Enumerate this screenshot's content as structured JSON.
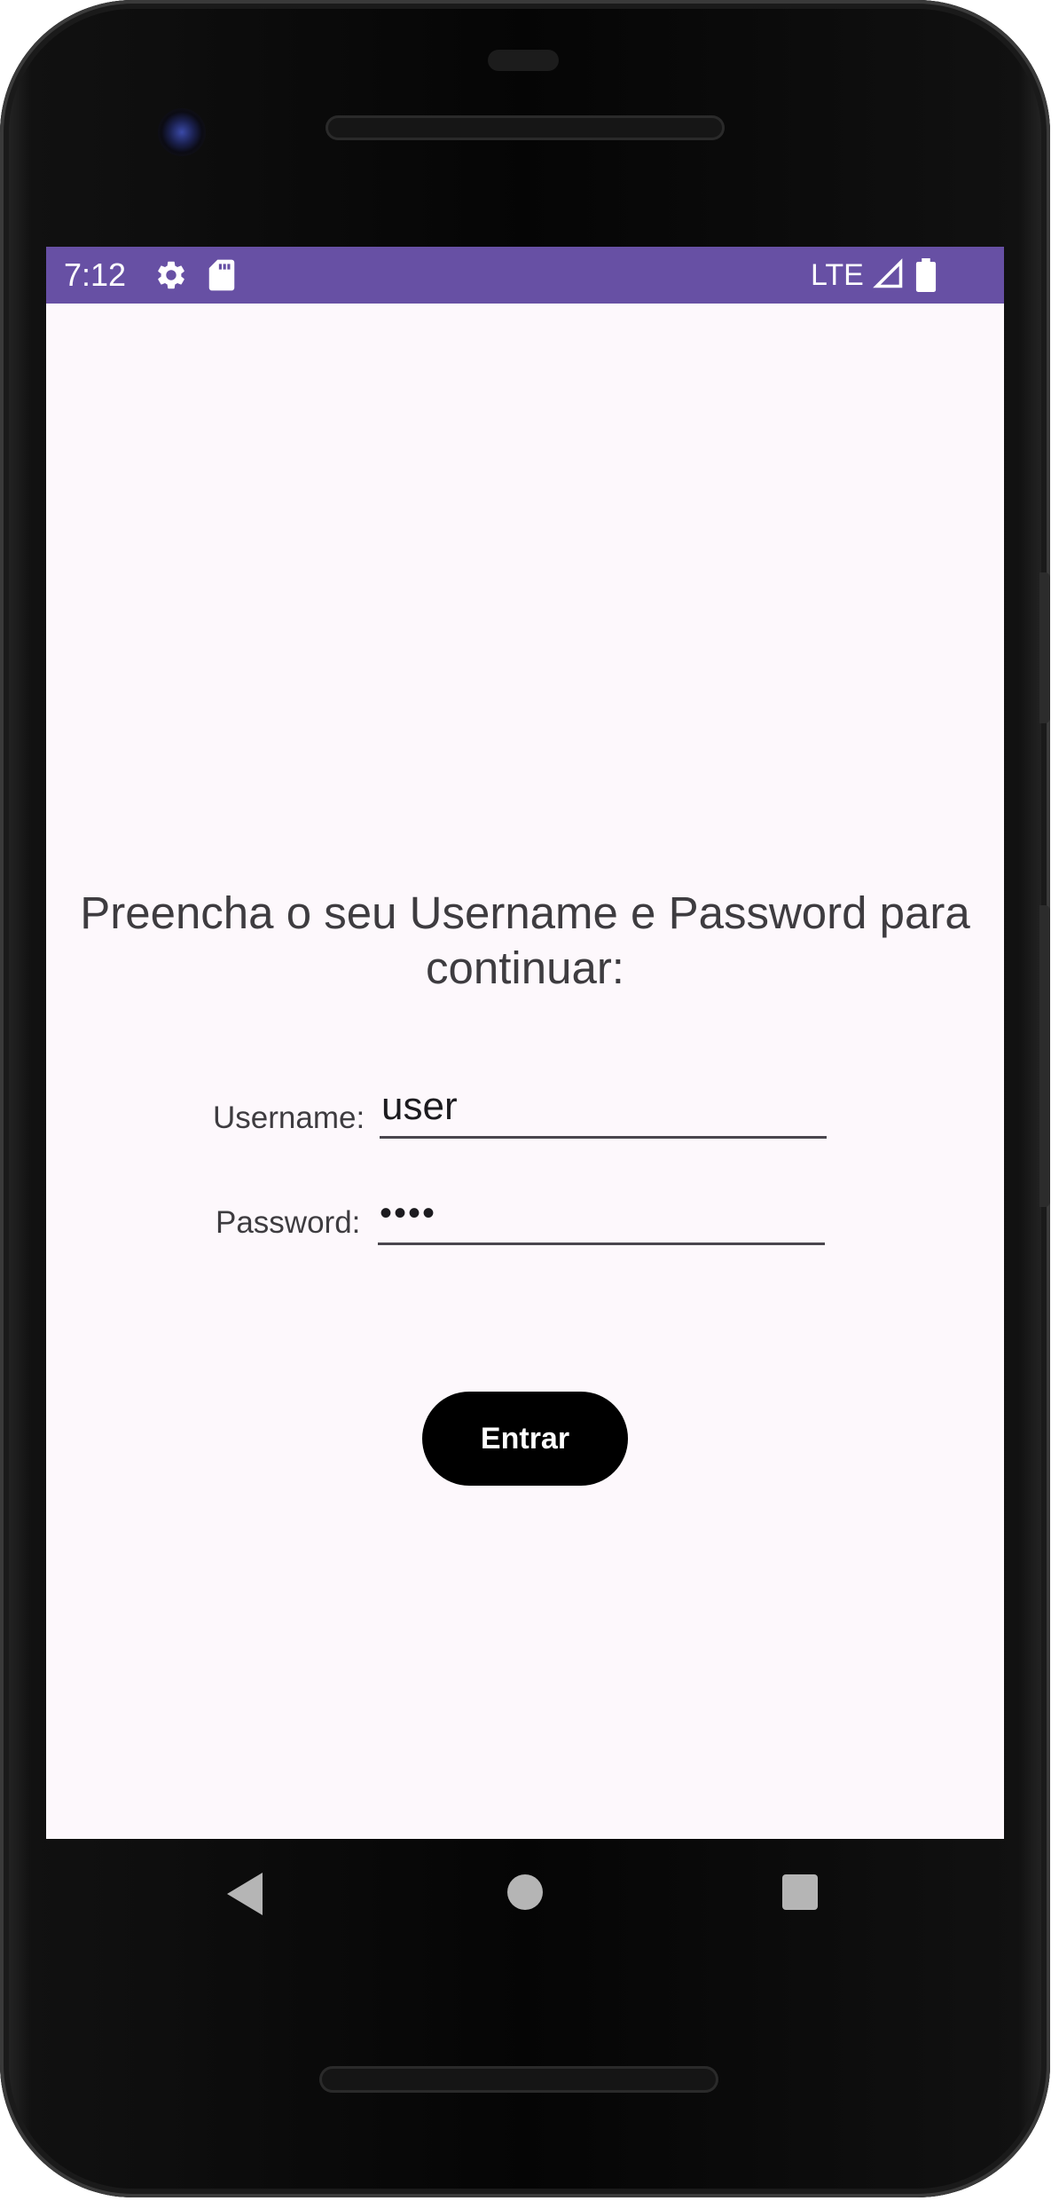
{
  "status_bar": {
    "time": "7:12",
    "network": "LTE",
    "background_color": "#6750a4",
    "icons": [
      "settings-icon",
      "sd-card-icon",
      "signal-icon",
      "battery-icon"
    ]
  },
  "login": {
    "prompt": "Preencha o seu Username e Password para continuar:",
    "username_label": "Username:",
    "username_value": "user",
    "password_label": "Password:",
    "password_value": "••••",
    "submit_label": "Entrar"
  },
  "nav_bar": {
    "icons": [
      "back-icon",
      "home-icon",
      "recents-icon"
    ]
  }
}
